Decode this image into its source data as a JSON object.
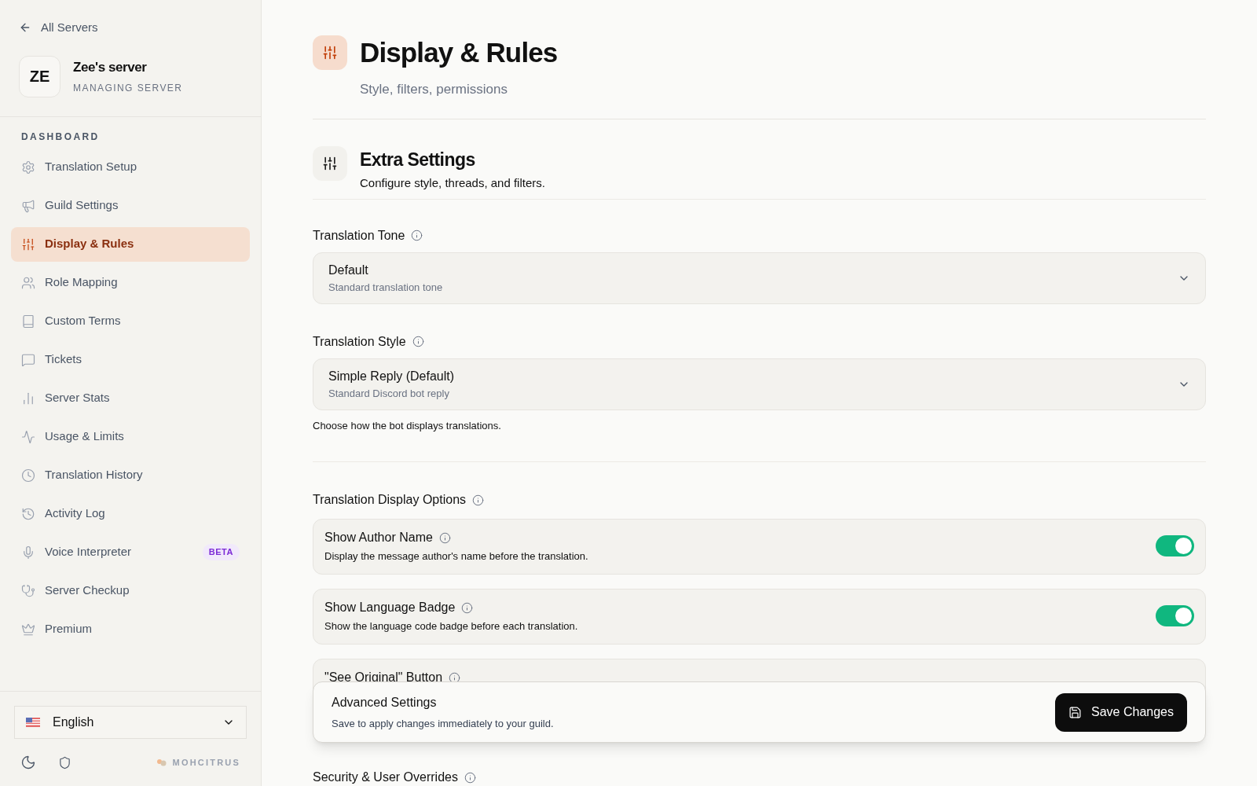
{
  "sidebar": {
    "back_link": "All Servers",
    "server": {
      "initials": "ZE",
      "name": "Zee's server",
      "role": "MANAGING SERVER"
    },
    "section_title": "DASHBOARD",
    "items": [
      {
        "label": "Translation Setup",
        "selected": false
      },
      {
        "label": "Guild Settings",
        "selected": false
      },
      {
        "label": "Display & Rules",
        "selected": true
      },
      {
        "label": "Role Mapping",
        "selected": false
      },
      {
        "label": "Custom Terms",
        "selected": false
      },
      {
        "label": "Tickets",
        "selected": false
      },
      {
        "label": "Server Stats",
        "selected": false
      },
      {
        "label": "Usage & Limits",
        "selected": false
      },
      {
        "label": "Translation History",
        "selected": false
      },
      {
        "label": "Activity Log",
        "selected": false
      },
      {
        "label": "Voice Interpreter",
        "selected": false,
        "badge": "BETA"
      },
      {
        "label": "Server Checkup",
        "selected": false
      },
      {
        "label": "Premium",
        "selected": false
      }
    ],
    "language": "English",
    "brand": "MOHCITRUS"
  },
  "header": {
    "title": "Display & Rules",
    "subtitle": "Style, filters, permissions"
  },
  "section": {
    "title": "Extra Settings",
    "description": "Configure style, threads, and filters."
  },
  "selects": [
    {
      "label": "Translation Tone",
      "value": "Default",
      "hint": "Standard translation tone"
    },
    {
      "label": "Translation Style",
      "value": "Simple Reply (Default)",
      "hint": "Standard Discord bot reply",
      "help": "Choose how the bot displays translations."
    }
  ],
  "display_options": {
    "label": "Translation Display Options",
    "toggles": [
      {
        "title": "Show Author Name",
        "description": "Display the message author's name before the translation.",
        "on": true
      },
      {
        "title": "Show Language Badge",
        "description": "Show the language code badge before each translation.",
        "on": true
      },
      {
        "title": "\"See Original\" Button"
      }
    ]
  },
  "save_bar": {
    "title": "Advanced Settings",
    "description": "Save to apply changes immediately to your guild.",
    "button": "Save Changes"
  },
  "next_section": "Security & User Overrides"
}
